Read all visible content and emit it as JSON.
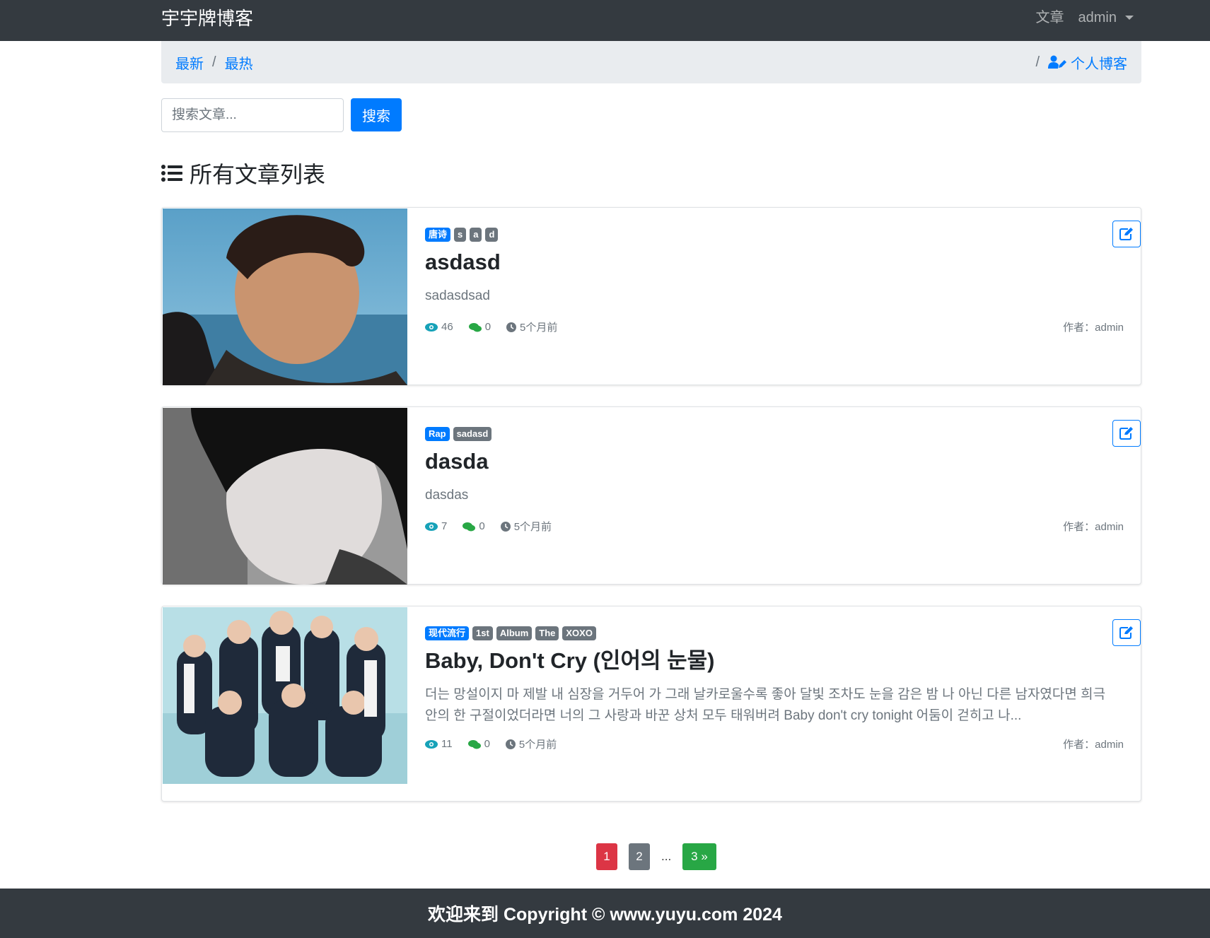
{
  "navbar": {
    "brand": "宇宇牌博客",
    "article_link": "文章",
    "user": "admin"
  },
  "breadcrumb": {
    "latest": "最新",
    "hot": "最热",
    "separator": "/",
    "personal_blog": "个人博客"
  },
  "search": {
    "placeholder": "搜索文章...",
    "button": "搜索"
  },
  "section_title": "所有文章列表",
  "posts": [
    {
      "tags": [
        "唐诗",
        "s",
        "a",
        "d"
      ],
      "title": "asdasd",
      "excerpt": "sadasdsad",
      "views": "46",
      "comments": "0",
      "time": "5个月前",
      "author": "作者：admin"
    },
    {
      "tags": [
        "Rap",
        "sadasd"
      ],
      "title": "dasda",
      "excerpt": "dasdas",
      "views": "7",
      "comments": "0",
      "time": "5个月前",
      "author": "作者：admin"
    },
    {
      "tags": [
        "现代流行",
        "1st",
        "Album",
        "The",
        "XOXO"
      ],
      "title": "Baby, Don't Cry (인어의 눈물)",
      "excerpt": "더는 망설이지 마 제발 내 심장을 거두어 가 그래 날카로울수록 좋아 달빛 조차도 눈을 감은 밤 나 아닌 다른 남자였다면 희극 안의 한 구절이었더라면 너의 그 사랑과 바꾼 상처 모두 태워버려 Baby don't cry tonight 어둠이 걷히고 나...",
      "views": "11",
      "comments": "0",
      "time": "5个月前",
      "author": "作者：admin"
    }
  ],
  "pagination": {
    "pages": [
      "1",
      "2"
    ],
    "ellipsis": "...",
    "next": "3 »"
  },
  "footer": "欢迎来到 Copyright © www.yuyu.com 2024",
  "colors": {
    "navbar": "#343a40",
    "primary": "#007bff",
    "secondary": "#6c757d",
    "views_icon": "#17a2b8",
    "comments_icon": "#28a745",
    "active_page": "#dc3545",
    "next_page": "#28a745"
  }
}
